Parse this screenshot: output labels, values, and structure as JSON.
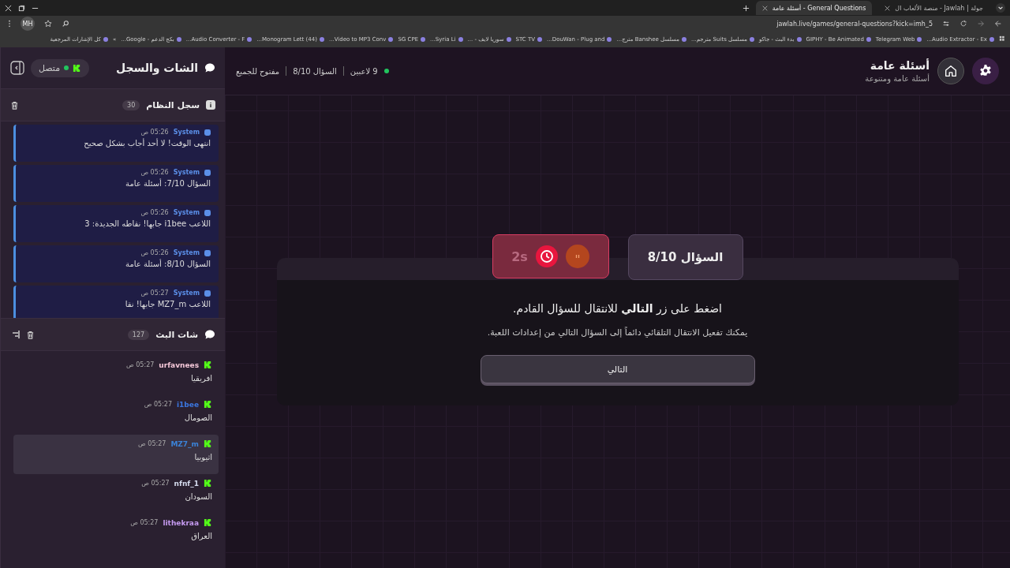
{
  "browser": {
    "tabs": [
      {
        "title": "جولة | Jawlah - منصة الألعاب ال",
        "selected": false
      },
      {
        "title": "General Questions - أسئلة عامة",
        "selected": true
      }
    ],
    "profile": "MH",
    "url": "jawlah.live/games/general-questions?kick=imh_5",
    "bookmarks": [
      "Audio Extractor - Ex...",
      "Telegram Web",
      "GIPHY - Be Animated",
      "بدء البث - جاكو",
      "مسلسل Suits مترجم...",
      "مسلسل Banshee مترج...",
      "DouWan - Plug and...",
      "STC TV",
      "سوريا لايف - ...",
      "Syria Li...",
      "SG CPE",
      "Video to MP3 Conv...",
      "(44) Monogram Lett...",
      "Audio Converter - F...",
      "بكج الدعم - Google..."
    ],
    "overflow": "»",
    "all_bookmarks": "كل الإشارات المرجعية"
  },
  "sidebar": {
    "title": "الشات والسجل",
    "status": "متصل",
    "connected": true,
    "system_log": {
      "title": "سجل النظام",
      "count": "30",
      "entries": [
        {
          "author": "System",
          "time": "05:26 ص",
          "text": "انتهى الوقت! لا أحد أجاب بشكل صحيح"
        },
        {
          "author": "System",
          "time": "05:26 ص",
          "text": "السؤال 7/10: أسئلة عامة"
        },
        {
          "author": "System",
          "time": "05:26 ص",
          "text": "اللاعب i1bee جابها! نقاطه الجديدة: 3"
        },
        {
          "author": "System",
          "time": "05:26 ص",
          "text": "السؤال 8/10: أسئلة عامة"
        },
        {
          "author": "System",
          "time": "05:27 ص",
          "text": "اللاعب MZ7_m جابها! نقا"
        }
      ]
    },
    "stream_chat": {
      "title": "شات البث",
      "count": "127",
      "messages": [
        {
          "user": "urfavnees",
          "color": "#f4c7d8",
          "time": "05:27 ص",
          "text": "افريقيا",
          "highlighted": false
        },
        {
          "user": "i1bee",
          "color": "#3b76e0",
          "time": "05:27 ص",
          "text": "الصومال",
          "highlighted": false
        },
        {
          "user": "MZ7_m",
          "color": "#3b82d6",
          "time": "05:27 ص",
          "text": "اثيوبيا",
          "highlighted": true
        },
        {
          "user": "nfnf_1",
          "color": "#d6dcef",
          "time": "05:27 ص",
          "text": "السودان",
          "highlighted": false
        },
        {
          "user": "lithekraa",
          "color": "#c59af0",
          "time": "05:27 ص",
          "text": "العراق",
          "highlighted": false
        }
      ]
    }
  },
  "header": {
    "title": "أسئلة عامة",
    "subtitle": "أسئلة عامة ومتنوعة",
    "players": "9 لاعبين",
    "question": "السؤال 8/10",
    "access": "مفتوح للجميع"
  },
  "game": {
    "question_badge": "السؤال 8/10",
    "timer": "2s",
    "paused": false,
    "prompt": "اضغط على زر **التالي** للانتقال للسؤال القادم.",
    "hint": "يمكنك تفعيل الانتقال التلقائي دائماً إلى السؤال التالي من إعدادات اللعبة.",
    "next_button": "التالي"
  }
}
